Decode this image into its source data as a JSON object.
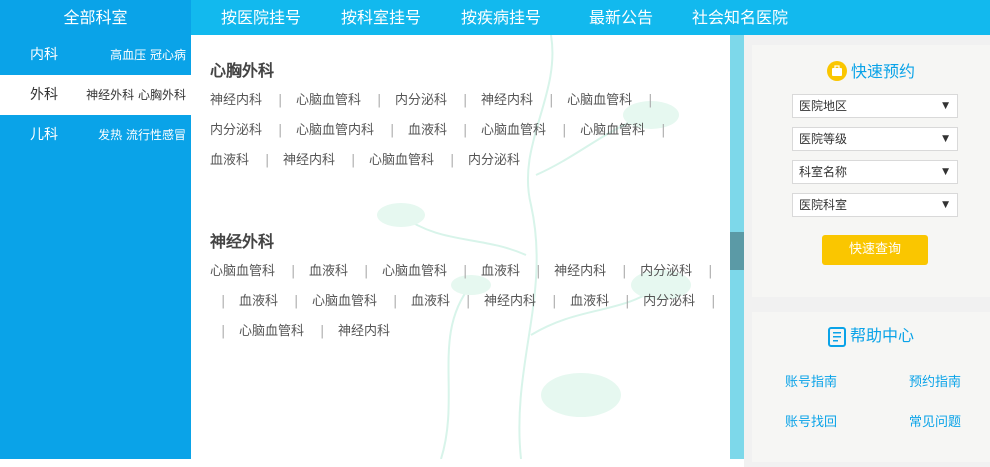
{
  "nav": {
    "all_departments": "全部科室",
    "items": [
      "按医院挂号",
      "按科室挂号",
      "按疾病挂号",
      "最新公告",
      "社会知名医院"
    ]
  },
  "sidebar": {
    "items": [
      {
        "label": "内科",
        "sub": "高血压 冠心病",
        "active": false
      },
      {
        "label": "外科",
        "sub": "神经外科 心胸外科",
        "active": true
      },
      {
        "label": "儿科",
        "sub": "发热 流行性感冒",
        "active": false
      }
    ]
  },
  "sections": [
    {
      "title": "心胸外科",
      "rows": [
        [
          "神经内科",
          "心脑血管科",
          "内分泌科",
          "神经内科",
          "心脑血管科"
        ],
        [
          "内分泌科",
          "心脑血管内科",
          "血液科",
          "心脑血管科",
          "心脑血管科"
        ],
        [
          "血液科",
          "神经内科",
          "心脑血管科",
          "内分泌科"
        ]
      ]
    },
    {
      "title": "神经外科",
      "rows": [
        [
          "心脑血管科",
          "血液科",
          "心脑血管科",
          "血液科",
          "神经内科",
          "内分泌科"
        ],
        [
          "血液科",
          "心脑血管科",
          "血液科",
          "神经内科",
          "血液科",
          "内分泌科"
        ],
        [
          "心脑血管科",
          "神经内科"
        ]
      ]
    }
  ],
  "quick_booking": {
    "title": "快速预约",
    "selects": [
      "医院地区",
      "医院等级",
      "科室名称",
      "医院科室"
    ],
    "button": "快速查询"
  },
  "help_center": {
    "title": "帮助中心",
    "links": [
      "账号指南",
      "预约指南",
      "账号找回",
      "常见问题"
    ]
  },
  "colors": {
    "nav_bar": "#12b9ee",
    "sidebar": "#0aa3e8",
    "accent": "#0aa3e8",
    "button": "#fac600"
  }
}
